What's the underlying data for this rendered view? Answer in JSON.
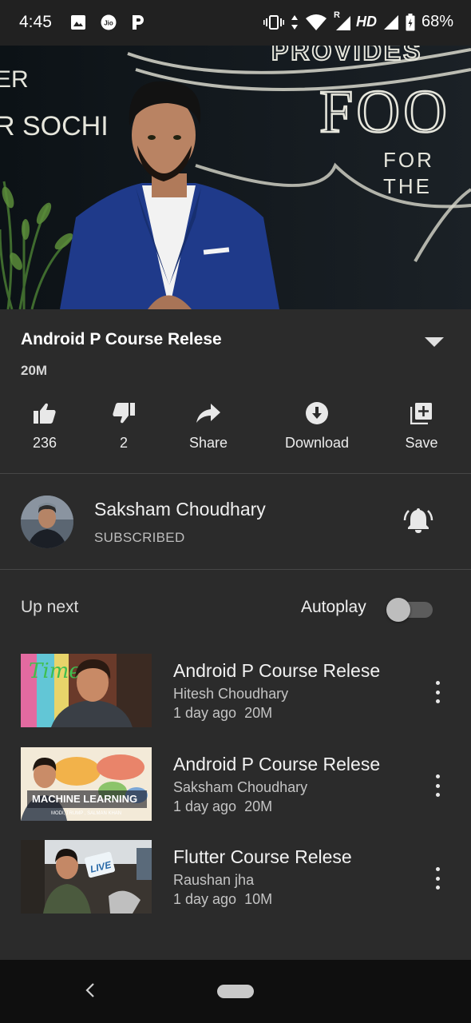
{
  "status_bar": {
    "time": "4:45",
    "left_icons": [
      "image-icon",
      "jio-icon",
      "paytm-icon"
    ],
    "right_icons": [
      "vibrate-icon",
      "data-arrows-icon",
      "wifi-icon",
      "signal-icon",
      "signal-icon-2",
      "battery-icon"
    ],
    "network": "HD",
    "roaming": "R",
    "battery": "68%"
  },
  "video_player": {
    "wall_text_left_1": "ER",
    "wall_text_left_2": "R SOCHI",
    "wall_text_top": "PROVIDES",
    "wall_text_big": "FOO",
    "wall_text_for": "FOR",
    "wall_text_the": "THE"
  },
  "video_info": {
    "title": "Android P Course Relese",
    "views": "20M",
    "actions": [
      {
        "label": "236",
        "icon": "thumbs-up-icon"
      },
      {
        "label": "2",
        "icon": "thumbs-down-icon"
      },
      {
        "label": "Share",
        "icon": "share-icon"
      },
      {
        "label": "Download",
        "icon": "download-icon"
      },
      {
        "label": "Save",
        "icon": "add-to-playlist-icon"
      }
    ]
  },
  "channel": {
    "name": "Saksham Choudhary",
    "status": "SUBSCRIBED",
    "bell_icon": "notification-bell-icon"
  },
  "up_next": {
    "label": "Up next",
    "autoplay_label": "Autoplay",
    "autoplay_on": false,
    "videos": [
      {
        "title": "Android P Course Relese",
        "channel": "Hitesh Choudhary",
        "age": "1 day ago",
        "views": "20M",
        "thumb_text": "Time"
      },
      {
        "title": "Android P Course Relese",
        "channel": "Saksham Choudhary",
        "age": "1 day ago",
        "views": "20M",
        "thumb_text": "MACHINE LEARNING",
        "thumb_subtext": "MODI, TRUMP , SALMAN KHAN"
      },
      {
        "title": "Flutter Course Relese",
        "channel": "Raushan jha",
        "age": "1 day ago",
        "views": "10M",
        "thumb_text": "LIVE"
      }
    ]
  },
  "colors": {
    "background": "#2b2b2b",
    "status_bar": "#212121",
    "nav_bar": "#0f0f0f",
    "divider": "#474747",
    "text_secondary": "#c4c4c4"
  }
}
